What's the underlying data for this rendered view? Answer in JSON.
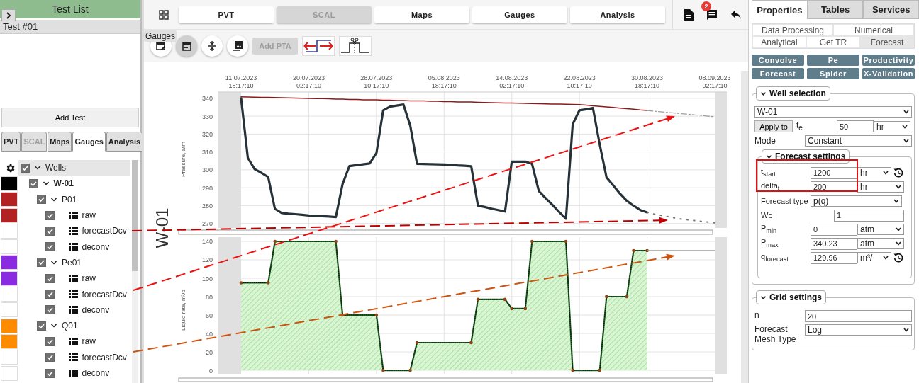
{
  "left_panel": {
    "title": "Test List",
    "tests": [
      {
        "label": "Test #01",
        "selected": true
      }
    ],
    "add_button": "Add Test",
    "tabs": [
      {
        "label": "PVT",
        "selected": false,
        "disabled": false
      },
      {
        "label": "SCAL",
        "selected": false,
        "disabled": true
      },
      {
        "label": "Maps",
        "selected": false,
        "disabled": false
      },
      {
        "label": "Gauges",
        "selected": true,
        "disabled": false
      },
      {
        "label": "Analysis",
        "selected": false,
        "disabled": false
      }
    ],
    "gauge_tree": {
      "label": "Wells",
      "checked": true,
      "expanded": true,
      "children": [
        {
          "label": "W-01",
          "color": "#000000",
          "checked": true,
          "expanded": true,
          "children": [
            {
              "label": "P01",
              "color": "#b22222",
              "checked": true,
              "expanded": true,
              "children": [
                {
                  "label": "raw",
                  "color": "#b22222",
                  "checked": true
                },
                {
                  "label": "forecastDcv",
                  "color": "#ffffff",
                  "checked": true
                },
                {
                  "label": "deconv",
                  "color": "#ffffff",
                  "checked": true
                }
              ]
            },
            {
              "label": "Pe01",
              "color": "#8a2be2",
              "checked": true,
              "expanded": true,
              "children": [
                {
                  "label": "raw",
                  "color": "#8a2be2",
                  "checked": true
                },
                {
                  "label": "forecastDcv",
                  "color": "#ffffff",
                  "checked": true
                },
                {
                  "label": "deconv",
                  "color": "#ffffff",
                  "checked": true
                }
              ]
            },
            {
              "label": "Q01",
              "color": "#ff8c00",
              "checked": true,
              "expanded": true,
              "children": [
                {
                  "label": "raw",
                  "color": "#ff8c00",
                  "checked": true
                },
                {
                  "label": "forecastDcv",
                  "color": "#ffffff",
                  "checked": true
                },
                {
                  "label": "deconv",
                  "color": "#ffffff",
                  "checked": true
                }
              ]
            }
          ]
        }
      ]
    }
  },
  "toolbar": {
    "tabs": [
      {
        "label": "PVT",
        "disabled": false
      },
      {
        "label": "SCAL",
        "disabled": true
      },
      {
        "label": "Maps",
        "disabled": false
      },
      {
        "label": "Gauges",
        "disabled": false
      },
      {
        "label": "Analysis",
        "disabled": false
      }
    ],
    "message_badge": "2"
  },
  "tools": {
    "tooltip": "Gauges",
    "add_pta": {
      "label": "Add PTA",
      "disabled": true
    }
  },
  "chart_area": {
    "well_label": "W-01",
    "pressure_chart": {
      "chart_data": {
        "type": "line",
        "grid": true,
        "ylabel": "Pressure, atm",
        "ylim": [
          267.5,
          343.5
        ],
        "yticks": [
          270,
          280,
          290,
          300,
          310,
          320,
          330,
          340
        ],
        "categories": [
          "11.07.2023 18:17:10",
          null,
          null,
          null,
          null,
          null,
          null,
          null,
          null,
          null,
          "20.07.2023 02:17:10",
          null,
          null,
          null,
          null,
          null,
          null,
          null,
          null,
          null,
          "28.07.2023 10:17:10",
          null,
          null,
          null,
          null,
          null,
          null,
          null,
          null,
          null,
          "05.08.2023 18:17:10",
          null,
          null,
          null,
          null,
          null,
          null,
          null,
          null,
          null,
          "14.08.2023 02:17:10",
          null,
          null,
          null,
          null,
          null,
          null,
          null,
          null,
          null,
          "22.08.2023 10:17:10",
          null,
          null,
          null,
          null,
          null,
          null,
          null,
          null,
          null,
          "30.08.2023 18:17:10",
          null,
          null,
          null,
          null,
          null,
          null,
          null,
          null,
          null,
          "08.09.2023 02:17:10"
        ],
        "series": [
          {
            "color": "#8b1a1a",
            "values": [
              340.8,
              340.7,
              340.6,
              340.5,
              340.5,
              340.4,
              340.3,
              340.2,
              340.1,
              340,
              339.9,
              339.8,
              339.8,
              339.7,
              339.6,
              339.5,
              339.4,
              339.3,
              339.2,
              339.2,
              339.1,
              339,
              338.9,
              338.8,
              338.7,
              338.6,
              338.5,
              338.5,
              338.4,
              338.3,
              338.2,
              338.1,
              338,
              338,
              337.9,
              337.8,
              337.7,
              337.6,
              337.5,
              337.4,
              337.4,
              337.3,
              337.2,
              337.1,
              337,
              336.9,
              336.8,
              336.8,
              336.7,
              336.6,
              336.5,
              336.2,
              335.8,
              335.5,
              335.2,
              334.9,
              334.5,
              334.2,
              333.9,
              333.5,
              333.2,
              null,
              null,
              null,
              null,
              null,
              null,
              null,
              null,
              null,
              null
            ]
          },
          {
            "color": "#9e9e9e",
            "line_style": "dashdot",
            "values": [
              null,
              null,
              null,
              null,
              null,
              null,
              null,
              null,
              null,
              null,
              null,
              null,
              null,
              null,
              null,
              null,
              null,
              null,
              null,
              null,
              null,
              null,
              null,
              null,
              null,
              null,
              null,
              null,
              null,
              null,
              null,
              null,
              null,
              null,
              null,
              null,
              null,
              null,
              null,
              null,
              null,
              null,
              null,
              null,
              null,
              null,
              null,
              null,
              null,
              null,
              null,
              null,
              null,
              null,
              null,
              null,
              null,
              null,
              null,
              null,
              333.2,
              332.8,
              332.5,
              332.1,
              331.8,
              331.4,
              331.1,
              330.7,
              330.4,
              330,
              329.7
            ]
          },
          {
            "color": "#263238",
            "values": [
              340,
              306.7,
              300.4,
              298.3,
              296,
              278.2,
              275.9,
              275.5,
              275.2,
              274.9,
              274.5,
              274.3,
              274.1,
              273.9,
              273.6,
              292,
              302.1,
              302.6,
              303.1,
              303.6,
              309.4,
              333.3,
              335.3,
              335.9,
              336.5,
              324.6,
              303.4,
              303.3,
              303.2,
              303.1,
              303,
              302.8,
              302.5,
              302.3,
              302,
              280,
              279.2,
              278.3,
              277.5,
              276.7,
              304.6,
              304.6,
              304.6,
              303.3,
              288.1,
              284.2,
              280.4,
              276.5,
              272.7,
              325.5,
              333.3,
              333.9,
              334.5,
              314,
              295.8,
              291.2,
              286.6,
              282.7,
              279.9,
              277.5,
              276.2,
              null,
              null,
              null,
              null,
              null,
              null,
              null,
              null,
              null,
              null
            ]
          },
          {
            "color": "#757575",
            "line_style": "dotted",
            "values": [
              null,
              null,
              null,
              null,
              null,
              null,
              null,
              null,
              null,
              null,
              null,
              null,
              null,
              null,
              null,
              null,
              null,
              null,
              null,
              null,
              null,
              null,
              null,
              null,
              null,
              null,
              null,
              null,
              null,
              null,
              null,
              null,
              null,
              null,
              null,
              null,
              null,
              null,
              null,
              null,
              null,
              null,
              null,
              null,
              null,
              null,
              null,
              null,
              null,
              null,
              null,
              null,
              null,
              null,
              null,
              null,
              null,
              null,
              null,
              null,
              276.2,
              275.3,
              274.6,
              273.9,
              273.2,
              272.5,
              272.1,
              271.6,
              271.2,
              270.8,
              270.4
            ]
          }
        ]
      }
    },
    "rate_chart": {
      "chart_data": {
        "type": "area",
        "grid": true,
        "ylabel": "Liquid rate, m³/d",
        "ylim": [
          -3.8,
          144.6
        ],
        "yticks": [
          0,
          20,
          40,
          60,
          80,
          100,
          120,
          140
        ],
        "categories": [
          null,
          null,
          null,
          null,
          null,
          null,
          null,
          null,
          null,
          null,
          null,
          null,
          null,
          null,
          null,
          null,
          null,
          null,
          null,
          null,
          null,
          null,
          null,
          null,
          null,
          null,
          null,
          null,
          null,
          null,
          null,
          null,
          null,
          null,
          null,
          null,
          null,
          null,
          null,
          null,
          null,
          null,
          null,
          null,
          null,
          null,
          null,
          null,
          null,
          null,
          null,
          null,
          null,
          null,
          null,
          null,
          null,
          null,
          null,
          null,
          null,
          null,
          null,
          null,
          null,
          null,
          null,
          null,
          null,
          null,
          null
        ],
        "series": [
          {
            "type": "area",
            "color": "#1b5e20",
            "values": [
              95,
              95,
              95,
              95,
              95,
              140,
              140,
              140,
              140,
              140,
              140,
              140,
              140,
              140,
              140,
              60,
              60,
              60,
              60,
              60,
              60,
              0,
              0,
              0,
              0,
              0,
              30,
              30,
              30,
              30,
              30,
              30,
              30,
              30,
              30,
              77,
              77,
              77,
              77,
              77,
              67,
              67,
              67,
              140,
              140,
              140,
              140,
              140,
              140,
              0,
              0,
              0,
              0,
              0,
              80,
              80,
              80,
              80,
              130,
              130,
              130,
              null,
              null,
              null,
              null,
              null,
              null,
              null,
              null,
              null,
              null
            ]
          },
          {
            "type": "line",
            "color": "#9e9e9e",
            "values": [
              null,
              null,
              null,
              null,
              null,
              null,
              null,
              null,
              null,
              null,
              null,
              null,
              null,
              null,
              null,
              null,
              null,
              null,
              null,
              null,
              null,
              null,
              null,
              null,
              null,
              null,
              null,
              null,
              null,
              null,
              null,
              null,
              null,
              null,
              null,
              null,
              null,
              null,
              null,
              null,
              null,
              null,
              null,
              null,
              null,
              null,
              null,
              null,
              null,
              null,
              null,
              null,
              null,
              null,
              null,
              null,
              null,
              null,
              null,
              null,
              130,
              130,
              130,
              130,
              130,
              130,
              130,
              130,
              130,
              130,
              130
            ]
          }
        ]
      }
    }
  },
  "right_panel": {
    "tabs": [
      {
        "label": "Properties",
        "selected": true
      },
      {
        "label": "Tables",
        "selected": false
      },
      {
        "label": "Services",
        "selected": false
      }
    ],
    "subtab_rows": [
      {
        "tabs": [
          {
            "label": "Data Processing",
            "selected": false
          },
          {
            "label": "Numerical",
            "selected": false
          }
        ]
      },
      {
        "tabs": [
          {
            "label": "Analytical",
            "selected": false
          },
          {
            "label": "Get TR",
            "selected": false
          },
          {
            "label": "Forecast",
            "selected": true
          }
        ]
      }
    ],
    "actions": [
      "Convolve",
      "Pe",
      "Productivity",
      "Forecast",
      "Spider",
      "X-Validation"
    ],
    "well_selection": {
      "title": "Well selection",
      "expanded": true,
      "well": "W-01",
      "apply_button": "Apply to",
      "te_label": "t$_{e}$",
      "te_value": "50",
      "te_unit": "hr",
      "mode_label": "Mode",
      "mode": "Constant",
      "forecast_settings": {
        "title": "Forecast settings",
        "expanded": true,
        "rows": [
          {
            "kind": "unit_reset",
            "label": "t$_{start}$",
            "value": "1200",
            "unit": "hr"
          },
          {
            "kind": "unit",
            "label": "delta$_{t}$",
            "value": "200",
            "unit": "hr"
          },
          {
            "kind": "select",
            "label": "Forecast type",
            "value": "p(q)"
          },
          {
            "kind": "input",
            "label": "Wc",
            "value": "1"
          },
          {
            "kind": "unit",
            "label": "P$_{min}$",
            "value": "0",
            "unit": "atm"
          },
          {
            "kind": "unit",
            "label": "P$_{max}$",
            "value": "340.23",
            "unit": "atm"
          },
          {
            "kind": "unit_reset",
            "label": "q$_{forecast}$",
            "value": "129.96",
            "unit": "m³/"
          }
        ]
      }
    },
    "grid_settings": {
      "title": "Grid settings",
      "expanded": true,
      "rows": [
        {
          "kind": "input",
          "label": "n",
          "value": "20"
        },
        {
          "kind": "select",
          "label": "Forecast Mesh Type",
          "value": "Log"
        }
      ]
    }
  }
}
